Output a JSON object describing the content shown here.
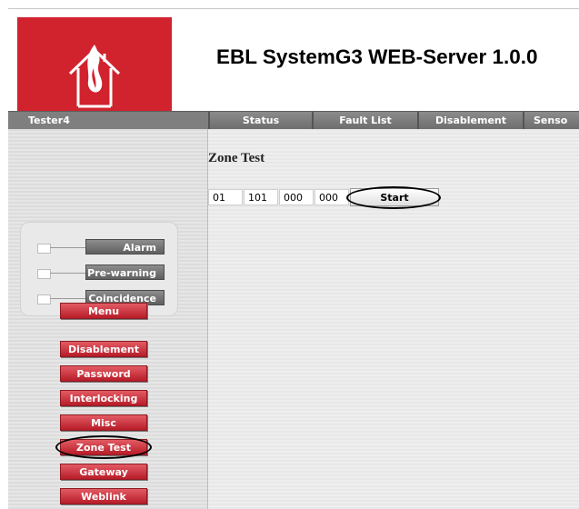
{
  "app": {
    "title": "EBL SystemG3 WEB-Server 1.0.0"
  },
  "navbar": {
    "user": "Tester4",
    "tabs": [
      "Status",
      "Fault List",
      "Disablement",
      "Senso"
    ]
  },
  "status_indicators": [
    {
      "label": "Alarm"
    },
    {
      "label": "Pre-warning"
    },
    {
      "label": "Coincidence"
    }
  ],
  "menu": {
    "header": "Menu",
    "items": [
      "Disablement",
      "Password",
      "Interlocking",
      "Misc",
      "Zone Test",
      "Gateway",
      "Weblink"
    ],
    "selected": "Zone Test"
  },
  "zone_test": {
    "title": "Zone Test",
    "fields": [
      "01",
      "101",
      "000",
      "000"
    ],
    "start_label": "Start"
  },
  "colors": {
    "brand_red": "#d0232e",
    "nav_gray": "#7f7f7f",
    "menu_red": "#c42a34"
  }
}
